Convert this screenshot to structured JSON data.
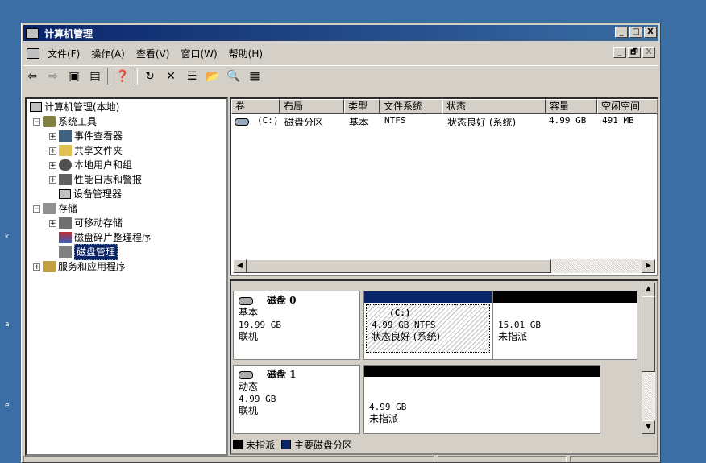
{
  "window": {
    "title": "计算机管理",
    "min": "_",
    "max": "□",
    "close": "X"
  },
  "menu": {
    "items": [
      {
        "label": "文件(F)"
      },
      {
        "label": "操作(A)"
      },
      {
        "label": "查看(V)"
      },
      {
        "label": "窗口(W)"
      },
      {
        "label": "帮助(H)"
      }
    ],
    "mdi_min": "_",
    "mdi_restore": "🗗",
    "mdi_close": "X"
  },
  "toolbar": {
    "back": "⇦",
    "forward": "⇨",
    "up": "▣",
    "show_hide": "▤",
    "help": "❓",
    "refresh": "↻",
    "delete": "✕",
    "properties": "☰",
    "open": "📂",
    "search": "🔍",
    "options": "▦"
  },
  "tree": {
    "root": "计算机管理(本地)",
    "system_tools": "系统工具",
    "event_viewer": "事件查看器",
    "shared_folders": "共享文件夹",
    "local_users": "本地用户和组",
    "perf_logs": "性能日志和警报",
    "device_manager": "设备管理器",
    "storage": "存储",
    "removable": "可移动存储",
    "defrag": "磁盘碎片整理程序",
    "disk_mgmt": "磁盘管理",
    "services": "服务和应用程序"
  },
  "volume_list": {
    "headers": [
      "卷",
      "布局",
      "类型",
      "文件系统",
      "状态",
      "容量",
      "空闲空间"
    ],
    "rows": [
      {
        "volume": "(C:)",
        "layout": "磁盘分区",
        "type": "基本",
        "fs": "NTFS",
        "status": "状态良好 (系统)",
        "capacity": "4.99 GB",
        "free": "491 MB"
      }
    ]
  },
  "disks": [
    {
      "name": "磁盘 0",
      "kind": "基本",
      "size": "19.99 GB",
      "state": "联机",
      "partitions": [
        {
          "label": "(C:)",
          "size": "4.99 GB NTFS",
          "status": "状态良好 (系统)"
        },
        {
          "size": "15.01 GB",
          "status": "未指派"
        }
      ]
    },
    {
      "name": "磁盘 1",
      "kind": "动态",
      "size": "4.99 GB",
      "state": "联机",
      "partitions": [
        {
          "size": "4.99 GB",
          "status": "未指派"
        }
      ]
    }
  ],
  "legend": {
    "unallocated": "未指派",
    "primary": "主要磁盘分区"
  },
  "colors": {
    "title_start": "#0a246a",
    "primary_partition": "#0a246a",
    "unallocated": "#000000",
    "desktop": "#3a6ea5"
  },
  "desktop": {
    "side_letters": [
      "k",
      "a",
      "e"
    ]
  }
}
